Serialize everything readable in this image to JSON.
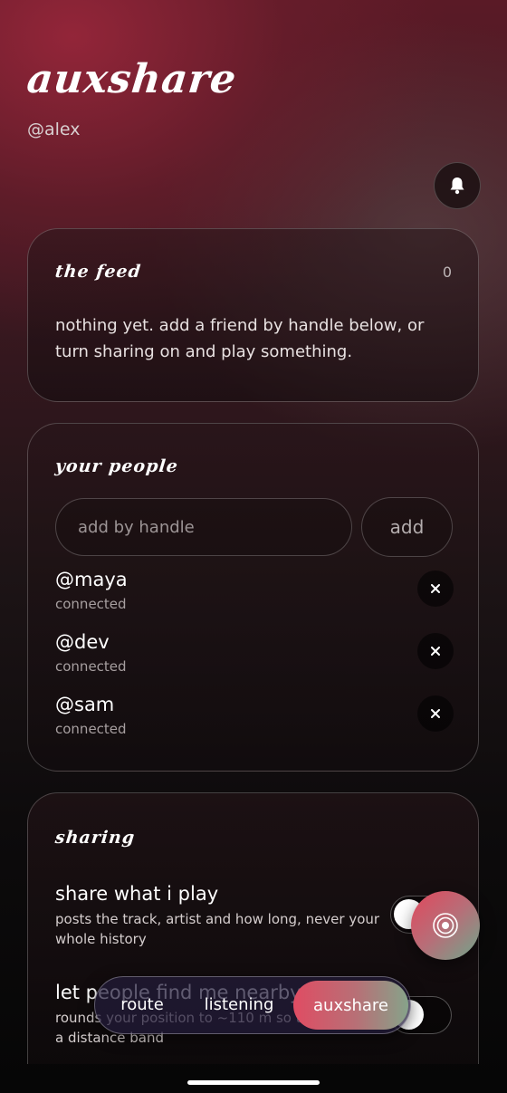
{
  "header": {
    "app_title": "auxshare",
    "handle": "@alex"
  },
  "feed": {
    "title": "the feed",
    "count": "0",
    "empty_message": "nothing yet. add a friend by handle below, or turn sharing on and play something."
  },
  "people": {
    "title": "your people",
    "input_placeholder": "add by handle",
    "add_label": "add",
    "list": [
      {
        "handle": "@maya",
        "status": "connected"
      },
      {
        "handle": "@dev",
        "status": "connected"
      },
      {
        "handle": "@sam",
        "status": "connected"
      }
    ]
  },
  "sharing": {
    "title": "sharing",
    "settings": [
      {
        "title": "share what i play",
        "description": "posts the track, artist and how long, never your whole history",
        "enabled": true
      },
      {
        "title": "let people find me nearby",
        "description": "rounds your position to ~110 m so they only see a distance band",
        "enabled": true
      }
    ]
  },
  "tabbar": {
    "tabs": [
      {
        "label": "route",
        "active": false
      },
      {
        "label": "listening",
        "active": false
      },
      {
        "label": "auxshare",
        "active": true
      }
    ]
  },
  "icons": {
    "bell": "bell-icon",
    "remove": "close-icon",
    "fab": "broadcast-icon"
  },
  "colors": {
    "accent_start": "#e04c63",
    "accent_end": "#86a38a",
    "background_top": "#96263a"
  }
}
